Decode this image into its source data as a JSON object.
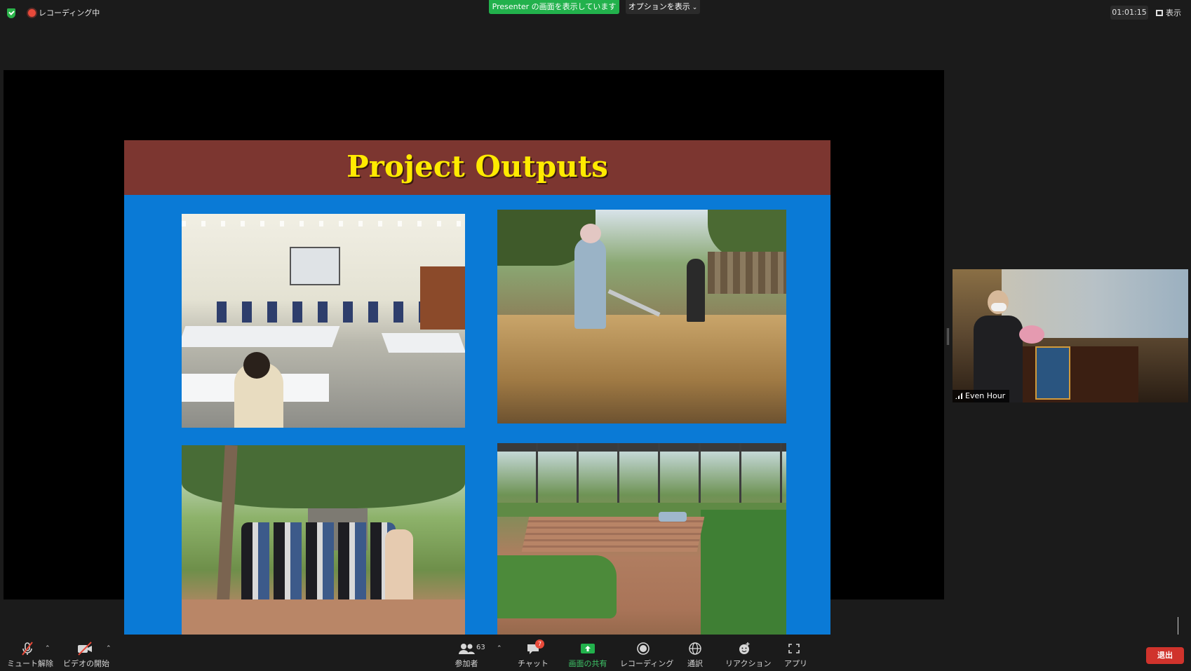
{
  "recording": {
    "label": "レコーディング中"
  },
  "share": {
    "banner": "Presenter の画面を表示しています",
    "options": "オプションを表示"
  },
  "timer": "01:01:15",
  "view": {
    "label": "表示"
  },
  "slide": {
    "title": "Project Outputs",
    "photos": [
      "training-hall-photo",
      "composting-photo",
      "community-group-photo",
      "vegetable-nursery-photo"
    ]
  },
  "participant": {
    "name": "Even Hour"
  },
  "toolbar": {
    "mute": "ミュート解除",
    "video": "ビデオの開始",
    "participants": "参加者",
    "participants_count": "63",
    "chat": "チャット",
    "chat_badge": "7",
    "share": "画面の共有",
    "record": "レコーディング",
    "translate": "通訳",
    "reactions": "リアクション",
    "apps": "アプリ",
    "leave": "退出"
  },
  "colors": {
    "share_green": "#22b14c",
    "leave_red": "#d0332c",
    "slide_blue": "#0a7ad6",
    "slide_header": "#7c3630",
    "title_yellow": "#ffea00"
  }
}
